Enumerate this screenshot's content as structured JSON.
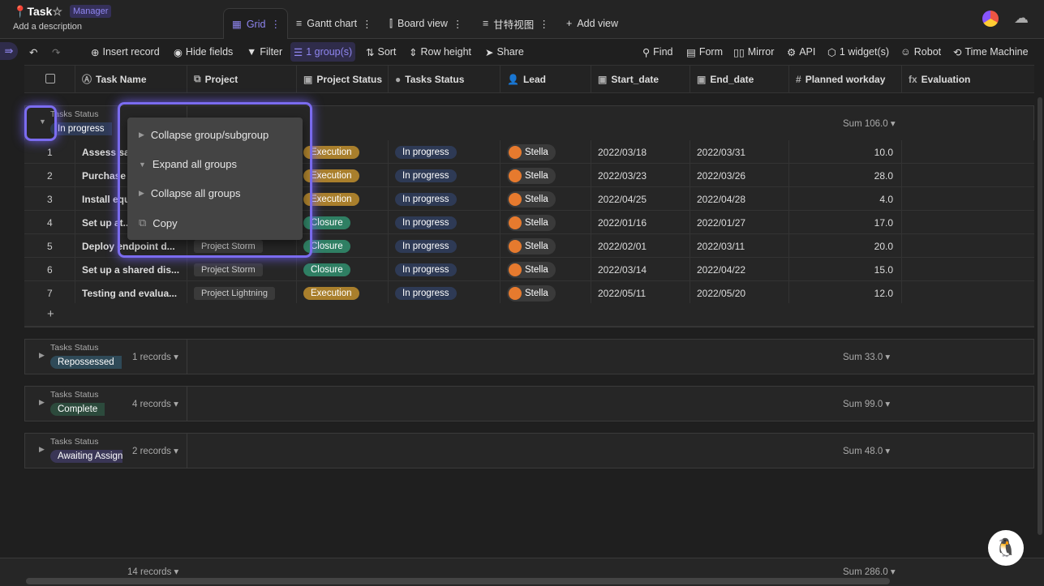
{
  "header": {
    "title": "Task",
    "role": "Manager",
    "description": "Add a description",
    "tabs": [
      {
        "label": "Grid"
      },
      {
        "label": "Gantt chart"
      },
      {
        "label": "Board view"
      },
      {
        "label": "甘特视图"
      }
    ],
    "add_view": "Add view"
  },
  "toolbar": {
    "left": [
      "Insert record",
      "Hide fields",
      "Filter",
      "1 group(s)",
      "Sort",
      "Row height",
      "Share"
    ],
    "right": [
      "Find",
      "Form",
      "Mirror",
      "API",
      "1 widget(s)",
      "Robot",
      "Time Machine"
    ]
  },
  "columns": [
    "Task Name",
    "Project",
    "Project Status",
    "Tasks Status",
    "Lead",
    "Start_date",
    "End_date",
    "Planned workday",
    "Evaluation"
  ],
  "group_label": "Tasks Status",
  "groups": [
    {
      "value": "In progress",
      "color": "#2e3a55",
      "sum": "Sum 106.0 ▾",
      "records": ""
    },
    {
      "value": "Repossessed",
      "color": "#2f4a58",
      "records": "1 records ▾",
      "sum": "Sum 33.0 ▾"
    },
    {
      "value": "Complete",
      "color": "#2c4a3c",
      "records": "4 records ▾",
      "sum": "Sum 99.0 ▾"
    },
    {
      "value": "Awaiting Assignment",
      "color": "#3a3656",
      "records": "2 records ▾",
      "sum": "Sum 48.0 ▾"
    }
  ],
  "rows": [
    {
      "n": "1",
      "task": "Assess sa...",
      "project": "",
      "pstatus": "Execution",
      "tstatus": "In progress",
      "lead": "Stella",
      "start": "2022/03/18",
      "end": "2022/03/31",
      "work": "10.0"
    },
    {
      "n": "2",
      "task": "Purchase t...",
      "project": "",
      "pstatus": "Execution",
      "tstatus": "In progress",
      "lead": "Stella",
      "start": "2022/03/23",
      "end": "2022/03/26",
      "work": "28.0"
    },
    {
      "n": "3",
      "task": "Install equ...",
      "project": "",
      "pstatus": "Execution",
      "tstatus": "In progress",
      "lead": "Stella",
      "start": "2022/04/25",
      "end": "2022/04/28",
      "work": "4.0"
    },
    {
      "n": "4",
      "task": "Set up at...",
      "project": "",
      "pstatus": "Closure",
      "tstatus": "In progress",
      "lead": "Stella",
      "start": "2022/01/16",
      "end": "2022/01/27",
      "work": "17.0"
    },
    {
      "n": "5",
      "task": "Deploy endpoint d...",
      "project": "Project Storm",
      "pstatus": "Closure",
      "tstatus": "In progress",
      "lead": "Stella",
      "start": "2022/02/01",
      "end": "2022/03/11",
      "work": "20.0"
    },
    {
      "n": "6",
      "task": "Set up a shared dis...",
      "project": "Project Storm",
      "pstatus": "Closure",
      "tstatus": "In progress",
      "lead": "Stella",
      "start": "2022/03/14",
      "end": "2022/04/22",
      "work": "15.0"
    },
    {
      "n": "7",
      "task": "Testing and evalua...",
      "project": "Project Lightning",
      "pstatus": "Execution",
      "tstatus": "In progress",
      "lead": "Stella",
      "start": "2022/05/11",
      "end": "2022/05/20",
      "work": "12.0"
    }
  ],
  "status_colors": {
    "Execution": "#a97f2c",
    "Closure": "#2f7f63",
    "In progress": "#2e3a55"
  },
  "add_row": "+",
  "menu": {
    "items": [
      "Collapse group/subgroup",
      "Expand all groups",
      "Collapse all groups",
      "Copy"
    ]
  },
  "footer": {
    "records": "14 records ▾",
    "sum": "Sum 286.0 ▾"
  }
}
